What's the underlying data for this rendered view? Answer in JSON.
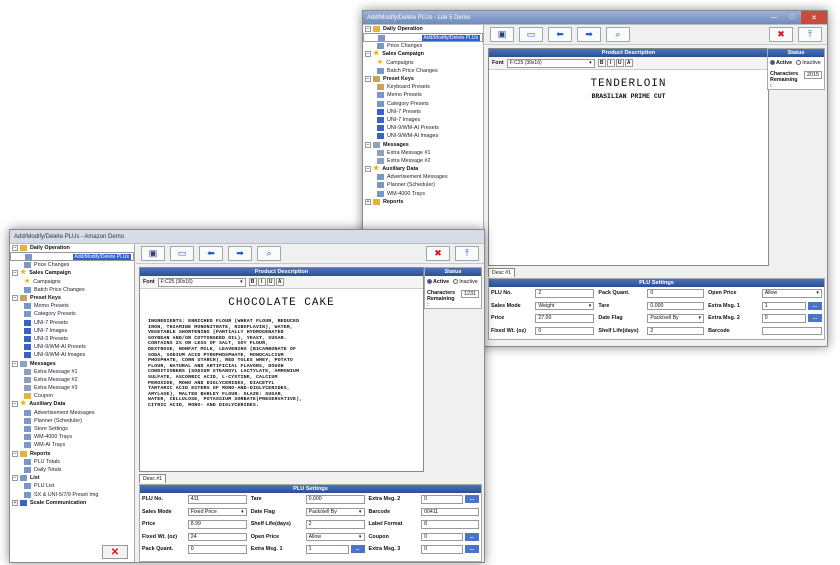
{
  "back_window": {
    "title": "Add/Modify/Delete PLUs - Lite 5 Demo",
    "tree": [
      {
        "label": "Daily Operation",
        "group": true,
        "toggle": "−",
        "icon": "folder-icon"
      },
      {
        "label": "Add/Modify/Delete PLUs",
        "indent": 1,
        "selected": true,
        "icon": "document-icon"
      },
      {
        "label": "Price Changes",
        "indent": 1,
        "icon": "document-icon"
      },
      {
        "label": "Sales Campaign",
        "group": true,
        "toggle": "−",
        "icon": "star-icon"
      },
      {
        "label": "Campaigns",
        "indent": 1,
        "icon": "star-icon"
      },
      {
        "label": "Batch Price Changes",
        "indent": 1,
        "icon": "document-icon"
      },
      {
        "label": "Preset Keys",
        "group": true,
        "toggle": "−",
        "icon": "keyboard-icon"
      },
      {
        "label": "Keyboard Presets",
        "indent": 1,
        "icon": "keyboard-icon"
      },
      {
        "label": "Memo Presets",
        "indent": 1,
        "icon": "document-icon"
      },
      {
        "label": "Category Presets",
        "indent": 1,
        "icon": "document-icon"
      },
      {
        "label": "UNI-7 Presets",
        "indent": 1,
        "icon": "preset-icon"
      },
      {
        "label": "UNI-7 Images",
        "indent": 1,
        "icon": "preset-icon"
      },
      {
        "label": "UNI-9/WM-AI Presets",
        "indent": 1,
        "icon": "preset-icon"
      },
      {
        "label": "UNI-9/WM-AI Images",
        "indent": 1,
        "icon": "preset-icon"
      },
      {
        "label": "Messages",
        "group": true,
        "toggle": "−",
        "icon": "message-icon"
      },
      {
        "label": "Extra Message #1",
        "indent": 1,
        "icon": "message-icon"
      },
      {
        "label": "Extra Message #2",
        "indent": 1,
        "icon": "message-icon"
      },
      {
        "label": "Auxiliary Data",
        "group": true,
        "toggle": "−",
        "icon": "star-icon"
      },
      {
        "label": "Advertisement Messages",
        "indent": 1,
        "icon": "document-icon"
      },
      {
        "label": "Planner (Scheduler)",
        "indent": 1,
        "icon": "document-icon"
      },
      {
        "label": "WM-4000 Trays",
        "indent": 1,
        "icon": "document-icon"
      },
      {
        "label": "Reports",
        "group": true,
        "toggle": "+",
        "icon": "folder-icon"
      }
    ],
    "desc_header": "Product Description",
    "status_header": "Status",
    "font_label": "Font",
    "font_value": "F:C25 (30x16)",
    "format_buttons": [
      "B",
      "I",
      "U",
      "A"
    ],
    "product_title": "TENDERLOIN",
    "product_subtitle": "BRASILIAN PRIME CUT",
    "status_active": "Active",
    "status_inactive": "Inactive",
    "chars_label": "Characters Remaining :",
    "chars_value": "2015",
    "tab_label": "Desc #1",
    "plu_header": "PLU Settings",
    "plu_rows": [
      [
        {
          "l": "PLU No."
        },
        {
          "v": "2"
        },
        {
          "l": "Pack Quant."
        },
        {
          "v": "0"
        },
        {
          "l": "Open Price"
        },
        {
          "v": "Allow",
          "dd": true
        }
      ],
      [
        {
          "l": "Sales Mode"
        },
        {
          "v": "Weight",
          "dd": true
        },
        {
          "l": "Tare"
        },
        {
          "v": "0.000"
        },
        {
          "l": "Extra Msg. 1"
        },
        {
          "v": "1",
          "dots": true
        }
      ],
      [
        {
          "l": "Price"
        },
        {
          "v": "27.00"
        },
        {
          "l": "Date Flag"
        },
        {
          "v": "Pack/sell By",
          "dd": true
        },
        {
          "l": "Extra Msg. 2"
        },
        {
          "v": "0",
          "dots": true
        }
      ],
      [
        {
          "l": "Fixed Wt. (oz)"
        },
        {
          "v": "0"
        },
        {
          "l": "Shelf Life(days)"
        },
        {
          "v": "2"
        },
        {
          "l": "Barcode"
        },
        {
          "v": ""
        }
      ]
    ]
  },
  "front_window": {
    "title": "Add/Modify/Delete PLUs - Amazon Demo",
    "tree": [
      {
        "label": "Daily Operation",
        "group": true,
        "toggle": "−",
        "icon": "folder-icon"
      },
      {
        "label": "Add/Modify/Delete PLUs",
        "indent": 1,
        "selected": true,
        "icon": "document-icon"
      },
      {
        "label": "Price Changes",
        "indent": 1,
        "icon": "document-icon"
      },
      {
        "label": "Sales Campaign",
        "group": true,
        "toggle": "−",
        "icon": "star-icon"
      },
      {
        "label": "Campaigns",
        "indent": 1,
        "icon": "star-icon"
      },
      {
        "label": "Batch Price Changes",
        "indent": 1,
        "icon": "document-icon"
      },
      {
        "label": "Preset Keys",
        "group": true,
        "toggle": "−",
        "icon": "keyboard-icon"
      },
      {
        "label": "Memo Presets",
        "indent": 1,
        "icon": "document-icon"
      },
      {
        "label": "Category Presets",
        "indent": 1,
        "icon": "document-icon"
      },
      {
        "label": "UNI-7 Presets",
        "indent": 1,
        "icon": "preset-icon"
      },
      {
        "label": "UNI-7 Images",
        "indent": 1,
        "icon": "preset-icon"
      },
      {
        "label": "UNI-3 Presets",
        "indent": 1,
        "icon": "preset-icon"
      },
      {
        "label": "UNI-9/WM-AI Presets",
        "indent": 1,
        "icon": "preset-icon"
      },
      {
        "label": "UNI-9/WM-AI Images",
        "indent": 1,
        "icon": "preset-icon"
      },
      {
        "label": "Messages",
        "group": true,
        "toggle": "−",
        "icon": "message-icon"
      },
      {
        "label": "Extra Message #1",
        "indent": 1,
        "icon": "message-icon"
      },
      {
        "label": "Extra Message #2",
        "indent": 1,
        "icon": "message-icon"
      },
      {
        "label": "Extra Message #3",
        "indent": 1,
        "icon": "message-icon"
      },
      {
        "label": "Coupon",
        "indent": 1,
        "icon": "folder-icon"
      },
      {
        "label": "Auxiliary Data",
        "group": true,
        "toggle": "−",
        "icon": "star-icon"
      },
      {
        "label": "Advertisement Messages",
        "indent": 1,
        "icon": "document-icon"
      },
      {
        "label": "Planner (Scheduler)",
        "indent": 1,
        "icon": "document-icon"
      },
      {
        "label": "Store Settings",
        "indent": 1,
        "icon": "document-icon"
      },
      {
        "label": "WM-4000 Trays",
        "indent": 1,
        "icon": "document-icon"
      },
      {
        "label": "WM-AI Trays",
        "indent": 1,
        "icon": "document-icon"
      },
      {
        "label": "Reports",
        "group": true,
        "toggle": "−",
        "icon": "folder-icon"
      },
      {
        "label": "PLU Totals",
        "indent": 1,
        "icon": "document-icon"
      },
      {
        "label": "Daily Totals",
        "indent": 1,
        "icon": "document-icon"
      },
      {
        "label": "List",
        "group": true,
        "toggle": "−",
        "icon": "document-icon"
      },
      {
        "label": "PLU List",
        "indent": 1,
        "icon": "document-icon"
      },
      {
        "label": "SX & UNI-5/7/9 Preset Img",
        "indent": 1,
        "icon": "document-icon"
      },
      {
        "label": "Scale Communication",
        "group": true,
        "toggle": "+",
        "icon": "preset-icon"
      }
    ],
    "desc_header": "Product Description",
    "status_header": "Status",
    "font_label": "Font",
    "font_value": "F:C25 (30x16)",
    "format_buttons": [
      "B",
      "I",
      "U",
      "A"
    ],
    "product_title": "CHOCOLATE CAKE",
    "ingredients": "INGREDIENTS: ENRICHED FLOUR (WHEAT FLOUR, REDUCED\nIRON, THIAMINE MONONITRATE, RIBOFLAVIN), WATER,\nVEGETABLE SHORTENING (PARTIALLY HYDROGENATED\nSOYBEAN AND/OR COTTONSEED OIL), YEAST, SUGAR.\nCONTAINS 2% OR LESS OF SALT, SOY FLOUR,\nDEXTROSE, NONFAT MILK, LEAVENING (BICARBONATE OF\nSODA, SODIUM ACID PYROPHOSPHATE, MONOCALCIUM\nPHOSPHATE, CORN STARCH), RED TOLES WHEY, POTATO\nFLOUR, NATURAL AND ARTIFICIAL FLAVORS, DOUGH\nCONDITIONERS (SODIUM STEAROYL LACTYLATE, AMMONIUM\nSULFATE, ASCORBIC ACID, L-CYSTINE, CALCIUM\nPEROXIDE, MONO AND DIGLYCERIDES, DIACETYL\nTARTARIC ACID ESTERS OF MONO-AND-DIGLYCERIDES,\nAMYLASE), MALTED BARLEY FLOUR. GLAZE: SUGAR,\nWATER, CELLULOSE, POTASSIUM SORBATE(PRESERVATIVE),\nCITRIC ACID, MONO- AND DIGLYCERIDES.",
    "status_active": "Active",
    "status_inactive": "Inactive",
    "chars_label": "Characters Remaining :",
    "chars_value": "1231",
    "tab_label": "Desc #1",
    "plu_header": "PLU Settings",
    "plu_rows": [
      [
        {
          "l": "PLU No."
        },
        {
          "v": "411"
        },
        {
          "l": "Tare"
        },
        {
          "v": "0.000"
        },
        {
          "l": "Extra Msg. 2"
        },
        {
          "v": "0",
          "dots": true
        }
      ],
      [
        {
          "l": "Sales Mode"
        },
        {
          "v": "Fixed Price",
          "dd": true
        },
        {
          "l": "Date Flag"
        },
        {
          "v": "Pack/sell By",
          "dd": true
        },
        {
          "l": "Barcode"
        },
        {
          "v": "00411"
        }
      ],
      [
        {
          "l": "Price"
        },
        {
          "v": "8.99"
        },
        {
          "l": "Shelf Life(days)"
        },
        {
          "v": "2"
        },
        {
          "l": "Label Format"
        },
        {
          "v": "8"
        }
      ],
      [
        {
          "l": "Fixed Wt. (oz)"
        },
        {
          "v": "24"
        },
        {
          "l": "Open Price"
        },
        {
          "v": "Allow",
          "dd": true
        },
        {
          "l": "Coupon"
        },
        {
          "v": "0",
          "dots": true
        }
      ],
      [
        {
          "l": "Pack Quant."
        },
        {
          "v": "0"
        },
        {
          "l": "Extra Msg. 1"
        },
        {
          "v": "1",
          "dots": true
        },
        {
          "l": "Extra Msg. 3"
        },
        {
          "v": "0",
          "dots": true
        }
      ]
    ]
  }
}
